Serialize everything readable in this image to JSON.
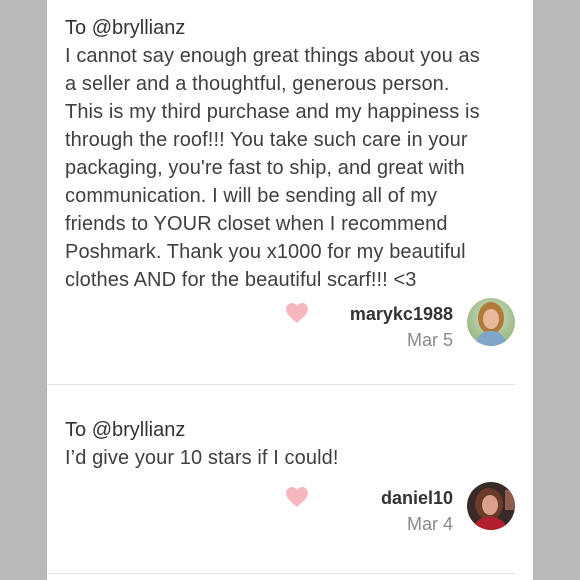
{
  "reviews": [
    {
      "to_prefix": "To",
      "to_handle": "@bryllianz",
      "message_lines": [
        "I cannot say enough great things about you as",
        "a seller and a thoughtful, generous person.",
        "This is my third purchase and my happiness is",
        "through the roof!!! You take such care in your",
        "packaging, you're fast to ship, and great with",
        "communication. I will be sending all of my",
        "friends to YOUR closet when I recommend",
        "Poshmark. Thank you x1000 for my beautiful",
        "clothes AND for the beautiful scarf!!! <3"
      ],
      "username": "marykc1988",
      "date": "Mar 5",
      "heart_icon": "heart-icon",
      "avatar_icon": "user-avatar"
    },
    {
      "to_prefix": "To",
      "to_handle": "@bryllianz",
      "message_lines": [
        "I’d give your 10 stars if I could!"
      ],
      "username": "daniel10",
      "date": "Mar 4",
      "heart_icon": "heart-icon",
      "avatar_icon": "user-avatar"
    }
  ],
  "colors": {
    "background": "#bdbdbd",
    "panel": "#ffffff",
    "heart": "#f7b7bf",
    "text": "#3f3f3f",
    "muted": "#8a8a8a"
  }
}
